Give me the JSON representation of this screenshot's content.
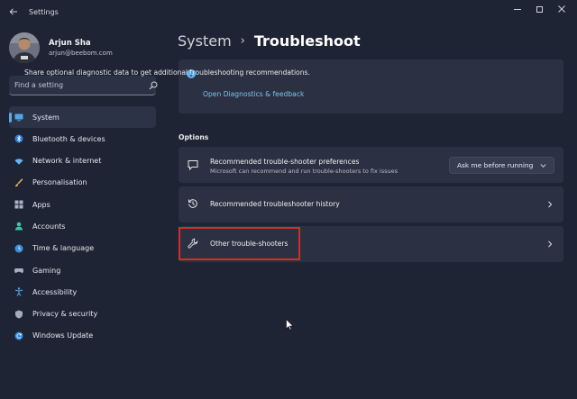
{
  "window": {
    "title": "Settings"
  },
  "profile": {
    "name": "Arjun Sha",
    "email": "arjun@beebom.com"
  },
  "search": {
    "placeholder": "Find a setting",
    "value": ""
  },
  "nav": {
    "items": [
      {
        "label": "System",
        "icon": "monitor-icon",
        "active": true
      },
      {
        "label": "Bluetooth & devices",
        "icon": "bluetooth-icon"
      },
      {
        "label": "Network & internet",
        "icon": "wifi-icon"
      },
      {
        "label": "Personalisation",
        "icon": "paintbrush-icon"
      },
      {
        "label": "Apps",
        "icon": "apps-icon"
      },
      {
        "label": "Accounts",
        "icon": "person-icon"
      },
      {
        "label": "Time & language",
        "icon": "globe-clock-icon"
      },
      {
        "label": "Gaming",
        "icon": "gamepad-icon"
      },
      {
        "label": "Accessibility",
        "icon": "accessibility-icon"
      },
      {
        "label": "Privacy & security",
        "icon": "shield-icon"
      },
      {
        "label": "Windows Update",
        "icon": "update-icon"
      }
    ]
  },
  "breadcrumb": {
    "parent": "System",
    "separator": "›",
    "current": "Troubleshoot"
  },
  "diagnostics": {
    "text": "Share optional diagnostic data to get additional troubleshooting recommendations.",
    "link": "Open Diagnostics & feedback"
  },
  "options": {
    "heading": "Options",
    "preferences": {
      "title": "Recommended trouble-shooter preferences",
      "subtitle": "Microsoft can recommend and run trouble-shooters to fix issues",
      "dropdown_value": "Ask me before running"
    },
    "history": {
      "title": "Recommended troubleshooter history"
    },
    "other": {
      "title": "Other trouble-shooters"
    }
  },
  "colors": {
    "background": "#1f2434",
    "card": "#2b3142",
    "accent": "#5ca8e8",
    "link": "#7fc3ef",
    "highlight": "#d62b2b"
  }
}
